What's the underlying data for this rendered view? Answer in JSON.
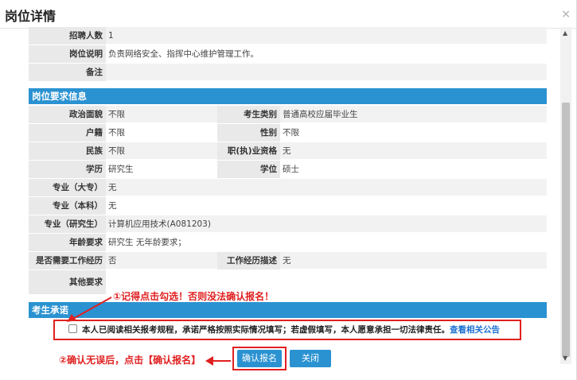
{
  "dialog": {
    "title": "岗位详情",
    "close_glyph": "×"
  },
  "top_rows": [
    {
      "label": "招聘人数",
      "value": "1"
    },
    {
      "label": "岗位说明",
      "value": "负责网络安全、指挥中心维护管理工作。"
    },
    {
      "label": "备注",
      "value": ""
    }
  ],
  "requirements": {
    "header": "岗位要求信息",
    "paired_rows": [
      {
        "label1": "政治面貌",
        "value1": "不限",
        "label2": "考生类别",
        "value2": "普通高校应届毕业生"
      },
      {
        "label1": "户籍",
        "value1": "不限",
        "label2": "性别",
        "value2": "不限"
      },
      {
        "label1": "民族",
        "value1": "不限",
        "label2": "职(执)业资格",
        "value2": "无"
      },
      {
        "label1": "学历",
        "value1": "研究生",
        "label2": "学位",
        "value2": "硕士"
      }
    ],
    "single_rows": [
      {
        "label": "专业（大专）",
        "value": "无"
      },
      {
        "label": "专业（本科）",
        "value": "无"
      },
      {
        "label": "专业（研究生）",
        "value": "计算机应用技术(A081203)"
      },
      {
        "label": "年龄要求",
        "value": "研究生 无年龄要求；"
      }
    ],
    "work_row": {
      "label1": "是否需要工作经历",
      "value1": "否",
      "label2": "工作经历描述",
      "value2": "无"
    },
    "other_row": {
      "label": "其他要求",
      "value": ""
    }
  },
  "promise": {
    "header": "考生承诺",
    "text": "本人已阅读相关报考规程，承诺严格按照实际情况填写；若虚假填写，本人愿意承担一切法律责任。",
    "link": "查看相关公告"
  },
  "annotations": {
    "step1": "①记得点击勾选！否则没法确认报名！",
    "step2": "②确认无误后，点击【确认报名】"
  },
  "buttons": {
    "confirm": "确认报名",
    "close": "关闭"
  },
  "colors": {
    "accent": "#2b92d1",
    "annotation": "#e02020",
    "link": "#1a6fd0"
  }
}
